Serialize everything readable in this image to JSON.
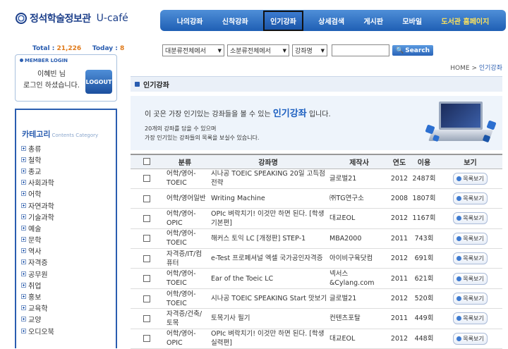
{
  "header": {
    "logo_text": "정석학술정보관",
    "logo_cafe": "U-café"
  },
  "nav": [
    {
      "label": "나의강좌"
    },
    {
      "label": "신착강좌"
    },
    {
      "label": "인기강좌"
    },
    {
      "label": "상세검색"
    },
    {
      "label": "게시판"
    },
    {
      "label": "모바일"
    },
    {
      "label": "도서관 홈페이지"
    }
  ],
  "stats": {
    "total_label": "Total :",
    "total": "21,226",
    "today_label": "Today :",
    "today": "8"
  },
  "login": {
    "title": "MEMBER LOGIN",
    "name_line1": "이혜빈 님",
    "name_line2": "로그인 하셨습니다.",
    "logout_label": "LOGOUT"
  },
  "category": {
    "title": "카테고리",
    "subtitle": "Contents Category",
    "items": [
      "총류",
      "철학",
      "종교",
      "사회과학",
      "어학",
      "자연과학",
      "기술과학",
      "예술",
      "문학",
      "역사",
      "자격증",
      "공무원",
      "취업",
      "홍보",
      "교육학",
      "교양",
      "오디오북"
    ]
  },
  "search": {
    "major": "대분류전체에서",
    "minor": "소분류전체에서",
    "field": "강좌명",
    "button": "Search"
  },
  "breadcrumb": {
    "home": "HOME",
    "sep": ">",
    "current": "인기강좌"
  },
  "section": {
    "title": "인기강좌"
  },
  "banner": {
    "pre": "이 곳은 가장 인기있는 강좌들을 볼 수 있는",
    "highlight": "인기강좌",
    "post": "입니다.",
    "line2": "20개의 강좌를 담을 수 있으며",
    "line3": "가장 인기있는 강좌들의 목록을 보실수 있습니다."
  },
  "table": {
    "headers": [
      "분류",
      "강좌명",
      "제작사",
      "연도",
      "이용",
      "보기"
    ],
    "view_label": "목록보기",
    "rows": [
      {
        "cat": "어학/영어-TOEIC",
        "title": "시나공 TOEIC SPEAKING 20일 고득점 전략",
        "maker": "글로벌21",
        "year": "2012",
        "uses": "2487회"
      },
      {
        "cat": "어학/영어일반",
        "title": "Writing Machine",
        "maker": "㈜TG연구소",
        "year": "2008",
        "uses": "1807회"
      },
      {
        "cat": "어학/영어-OPIC",
        "title": "OPIc 벼락치기! 이것만 하면 된다. [학생 기본편]",
        "maker": "대교EOL",
        "year": "2012",
        "uses": "1167회"
      },
      {
        "cat": "어학/영어-TOEIC",
        "title": "해커스 토익 LC [개정판] STEP-1",
        "maker": "MBA2000",
        "year": "2011",
        "uses": "743회"
      },
      {
        "cat": "자격증/IT/컴퓨터",
        "title": "e-Test 프로페셔널 엑셀 국가공인자격증",
        "maker": "아이비구육닷컴",
        "year": "2012",
        "uses": "691회"
      },
      {
        "cat": "어학/영어-TOEIC",
        "title": "Ear of the Toeic LC",
        "maker": "넥서스 &Cylang.com",
        "year": "2011",
        "uses": "621회"
      },
      {
        "cat": "어학/영어-TOEIC",
        "title": "시나공 TOEIC SPEAKING Start 맛보기",
        "maker": "글로벌21",
        "year": "2012",
        "uses": "520회"
      },
      {
        "cat": "자격증/건축/토목",
        "title": "토목기사 필기",
        "maker": "컨텐츠포탈",
        "year": "2011",
        "uses": "449회"
      },
      {
        "cat": "어학/영어-OPIC",
        "title": "OPIc 벼락치기! 이것만 하면 된다. [학생 실력편]",
        "maker": "대교EOL",
        "year": "2012",
        "uses": "448회"
      }
    ]
  }
}
